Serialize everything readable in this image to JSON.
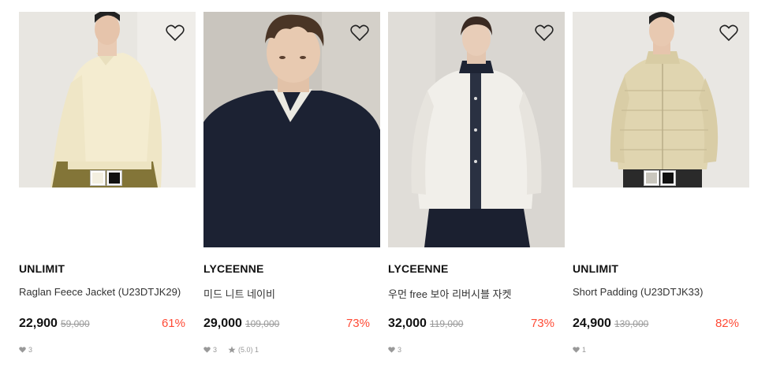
{
  "products": [
    {
      "brand": "UNLIMIT",
      "name": "Raglan Feece Jacket (U23DTJK29)",
      "price": "22,900",
      "original_price": "59,000",
      "discount": "61%",
      "likes": "3",
      "swatches": [
        "#f3efe0",
        "#111111"
      ],
      "image_icon": "cream-fleece-jacket-photo"
    },
    {
      "brand": "LYCEENNE",
      "name": "미드 니트 네이비",
      "price": "29,000",
      "original_price": "109,000",
      "discount": "73%",
      "likes": "3",
      "rating": "(5.0) 1",
      "image_icon": "navy-knit-sweater-photo"
    },
    {
      "brand": "LYCEENNE",
      "name": "우먼 free 보아 리버시블 자켓",
      "price": "32,000",
      "original_price": "119,000",
      "discount": "73%",
      "likes": "3",
      "image_icon": "white-boa-jacket-photo"
    },
    {
      "brand": "UNLIMIT",
      "name": "Short Padding (U23DTJK33)",
      "price": "24,900",
      "original_price": "139,000",
      "discount": "82%",
      "likes": "1",
      "swatches": [
        "#c9c6bd",
        "#111111"
      ],
      "image_icon": "beige-padding-jacket-photo"
    }
  ],
  "colors": {
    "discount": "#ff4a35",
    "meta": "#999999"
  }
}
